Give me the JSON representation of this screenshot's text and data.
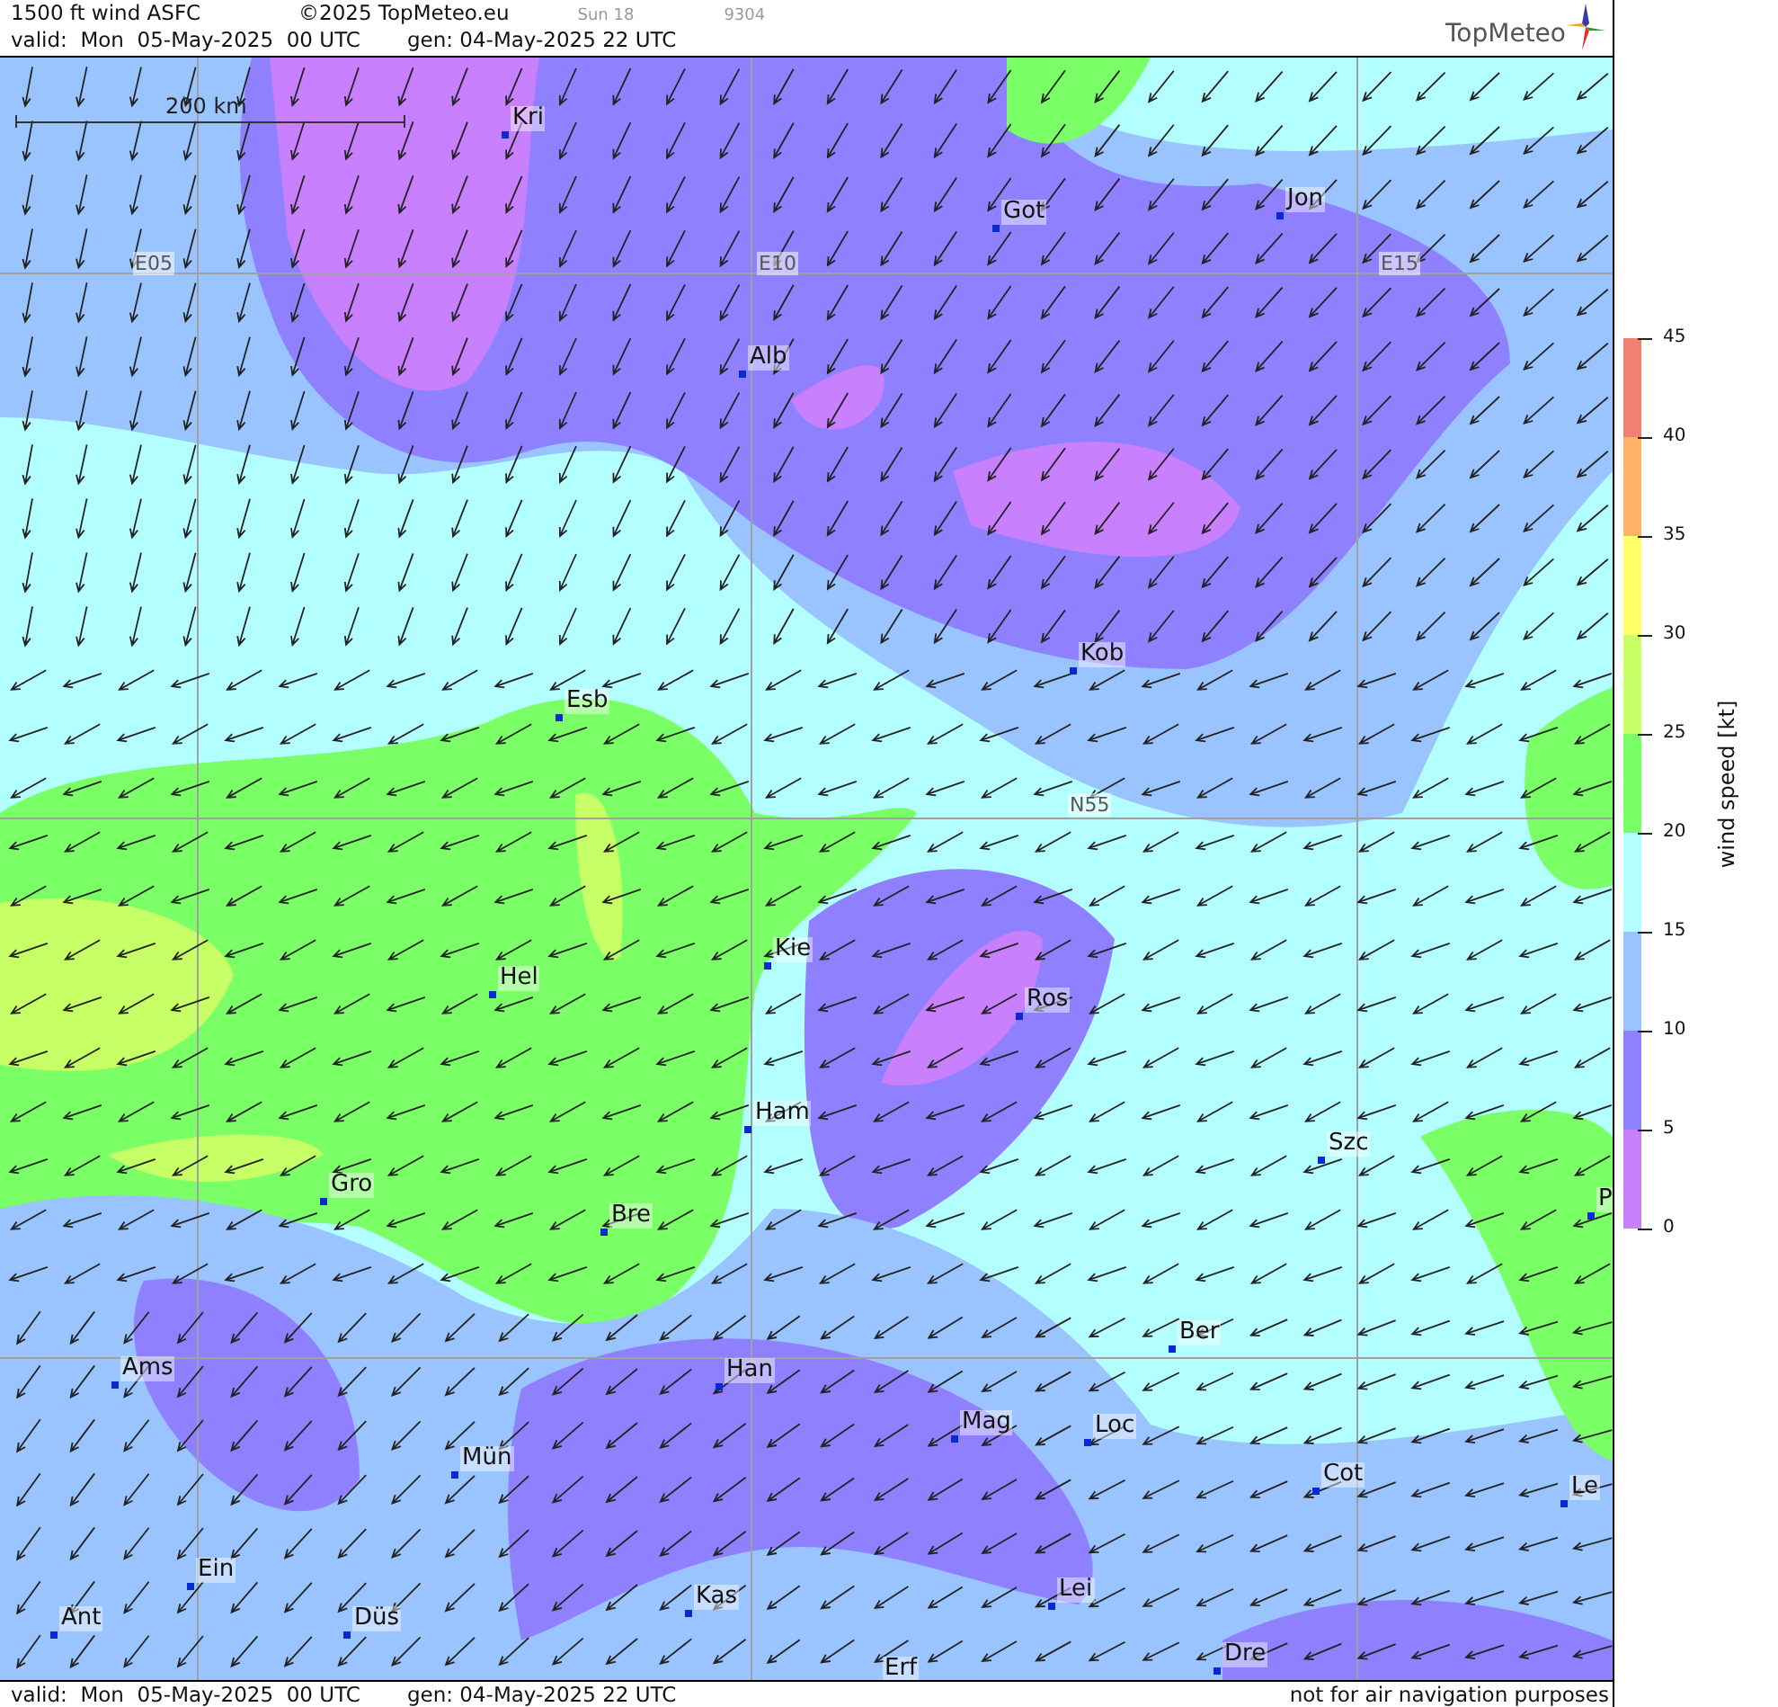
{
  "header": {
    "title": "1500 ft wind ASFC",
    "copyright": "©2025 TopMeteo.eu",
    "sun": "Sun 18",
    "code": "9304",
    "valid": "valid:  Mon  05-May-2025  00 UTC",
    "generated": "gen: 04-May-2025 22 UTC",
    "logo": "TopMeteo"
  },
  "map": {
    "scale_label": "200 km",
    "grid_labels": [
      "E05",
      "E10",
      "E15",
      "N55"
    ],
    "cities": [
      {
        "name": "Kri"
      },
      {
        "name": "Got"
      },
      {
        "name": "Jon"
      },
      {
        "name": "Alb"
      },
      {
        "name": "Kob"
      },
      {
        "name": "Esb"
      },
      {
        "name": "Kie"
      },
      {
        "name": "Hel"
      },
      {
        "name": "Ros"
      },
      {
        "name": "Ham"
      },
      {
        "name": "Szc"
      },
      {
        "name": "Gro"
      },
      {
        "name": "Bre"
      },
      {
        "name": "P"
      },
      {
        "name": "Ber"
      },
      {
        "name": "Ams"
      },
      {
        "name": "Han"
      },
      {
        "name": "Mag"
      },
      {
        "name": "Loc"
      },
      {
        "name": "Mün"
      },
      {
        "name": "Cot"
      },
      {
        "name": "Le"
      },
      {
        "name": "Ein"
      },
      {
        "name": "Kas"
      },
      {
        "name": "Lei"
      },
      {
        "name": "Ant"
      },
      {
        "name": "Düs"
      },
      {
        "name": "Dre"
      },
      {
        "name": "Erf"
      }
    ]
  },
  "legend": {
    "title": "wind speed [kt]",
    "ticks": [
      "45",
      "40",
      "35",
      "30",
      "25",
      "20",
      "15",
      "10",
      "5",
      "0"
    ],
    "bands": [
      {
        "color": "#f08070"
      },
      {
        "color": "#ffb366"
      },
      {
        "color": "#ffff66"
      },
      {
        "color": "#c6ff66"
      },
      {
        "color": "#7aff66"
      },
      {
        "color": "#b3ffff"
      },
      {
        "color": "#99c4ff"
      },
      {
        "color": "#8f80ff"
      },
      {
        "color": "#c880ff"
      }
    ]
  },
  "footer": {
    "valid": "valid:  Mon  05-May-2025  00 UTC",
    "generated": "gen: 04-May-2025 22 UTC",
    "disclaimer": "not for air navigation purposes"
  }
}
